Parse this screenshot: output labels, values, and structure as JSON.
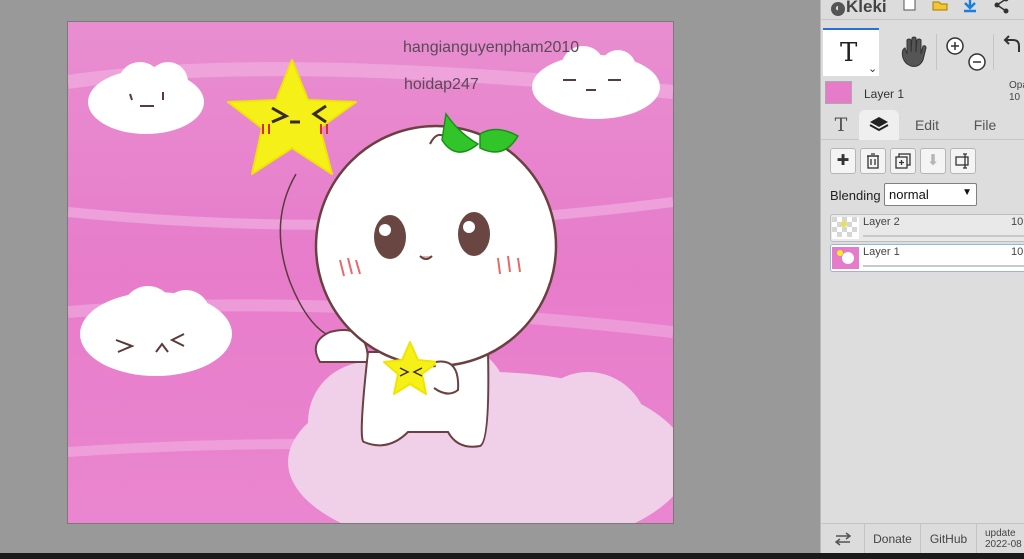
{
  "app": {
    "name": "Kleki"
  },
  "canvas": {
    "watermark_1": "hangianguyenpham2010",
    "watermark_2": "hoidap247"
  },
  "top_icons": [
    "new-icon",
    "open-icon",
    "download-icon",
    "share-icon"
  ],
  "tools": {
    "text_tool_glyph": "T",
    "hand_tool": "hand-icon",
    "zoom": [
      "zoom-in-icon",
      "zoom-out-icon"
    ],
    "undo": "undo-icon"
  },
  "current_layer": {
    "name": "Layer 1",
    "opacity_label": "Opa",
    "opacity_value": "10"
  },
  "tabs": [
    {
      "label": "T",
      "icon": "text-icon"
    },
    {
      "label": "",
      "icon": "layers-icon",
      "active": true
    },
    {
      "label": "Edit"
    },
    {
      "label": "File"
    }
  ],
  "layer_actions": [
    "add-layer-icon",
    "delete-layer-icon",
    "duplicate-layer-icon",
    "merge-down-icon",
    "rename-layer-icon"
  ],
  "blending": {
    "label": "Blending",
    "value": "normal"
  },
  "layers": [
    {
      "name": "Layer 2",
      "opacity": "10",
      "selected": false
    },
    {
      "name": "Layer 1",
      "opacity": "10",
      "selected": true
    }
  ],
  "footer": {
    "swap_icon": "swap-icon",
    "donate": "Donate",
    "github": "GitHub",
    "update_line1": "update",
    "update_line2": "2022-08"
  },
  "colors": {
    "canvas_pink": "#e57bc9",
    "panel_bg": "#dddddd",
    "workspace_bg": "#999999",
    "accent_blue": "#2a6fdb"
  }
}
